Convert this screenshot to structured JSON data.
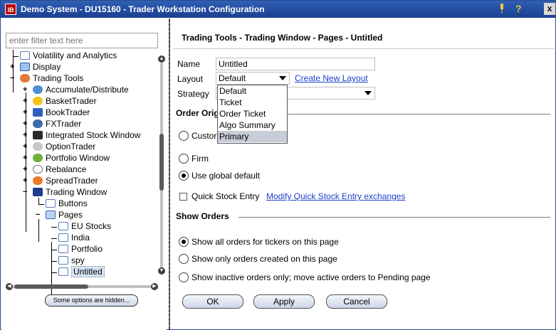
{
  "window": {
    "title": "Demo System - DU15160 - Trader Workstation Configuration",
    "logo_text": "IB",
    "help_glyph": "?",
    "close_glyph": "x"
  },
  "sidebar": {
    "filter_placeholder": "enter filter text here",
    "items": [
      {
        "label": "Volatility and Analytics",
        "icon": "doc-icon"
      },
      {
        "label": "Display",
        "icon": "monitor-icon"
      },
      {
        "label": "Trading Tools",
        "icon": "tools-icon"
      },
      {
        "label": "Accumulate/Distribute",
        "icon": "accumulate-icon"
      },
      {
        "label": "BasketTrader",
        "icon": "basket-icon"
      },
      {
        "label": "BookTrader",
        "icon": "book-icon"
      },
      {
        "label": "FXTrader",
        "icon": "fx-icon"
      },
      {
        "label": "Integrated Stock Window",
        "icon": "stock-window-icon"
      },
      {
        "label": "OptionTrader",
        "icon": "option-icon"
      },
      {
        "label": "Portfolio Window",
        "icon": "portfolio-icon"
      },
      {
        "label": "Rebalance",
        "icon": "rebalance-icon"
      },
      {
        "label": "SpreadTrader",
        "icon": "spread-icon"
      },
      {
        "label": "Trading Window",
        "icon": "ib-icon"
      },
      {
        "label": "Buttons",
        "icon": "doc-icon"
      },
      {
        "label": "Pages",
        "icon": "folder-icon"
      },
      {
        "label": "EU Stocks",
        "icon": "doc-icon"
      },
      {
        "label": "India",
        "icon": "doc-icon"
      },
      {
        "label": "Portfolio",
        "icon": "doc-icon"
      },
      {
        "label": "spy",
        "icon": "doc-icon"
      },
      {
        "label": "Untitled",
        "icon": "doc-icon"
      }
    ],
    "hidden_button": "Some options are hidden..."
  },
  "main": {
    "breadcrumb": "Trading Tools - Trading Window - Pages - Untitled",
    "name_label": "Name",
    "name_value": "Untitled",
    "layout_label": "Layout",
    "layout_value": "Default",
    "create_layout_link": "Create New Layout",
    "strategy_label": "Strategy",
    "layout_options": [
      "Default",
      "Ticket",
      "Order Ticket",
      "Algo Summary",
      "Primary"
    ],
    "order_origin_title_visible": "Order Orig",
    "origin_options": [
      {
        "label": "Custor",
        "selected": false
      },
      {
        "label": "Firm",
        "selected": false
      },
      {
        "label": "Use global default",
        "selected": true
      }
    ],
    "quick_stock_label": "Quick Stock Entry",
    "quick_stock_link": "Modify Quick Stock Entry exchanges",
    "show_orders_title": "Show Orders",
    "show_orders_options": [
      {
        "label": "Show all orders for tickers on this page",
        "selected": true
      },
      {
        "label": "Show only orders created on this page",
        "selected": false
      },
      {
        "label": "Show inactive orders only; move active orders to Pending page",
        "selected": false
      }
    ]
  },
  "buttons": {
    "ok": "OK",
    "apply": "Apply",
    "cancel": "Cancel"
  },
  "colors": {
    "titlebar": "#1f4a9e",
    "link": "#1c3fc9",
    "selection": "#c6cdd6"
  }
}
